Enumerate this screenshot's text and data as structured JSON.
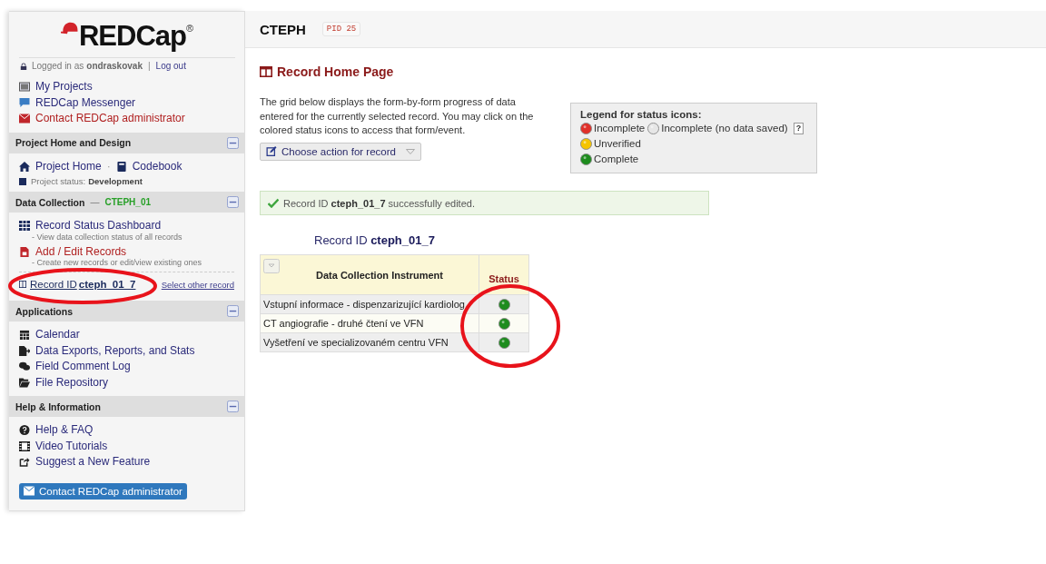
{
  "logo": {
    "text": "REDCap",
    "mark": "®"
  },
  "login": {
    "prefix": "Logged in as",
    "user": "ondraskovak",
    "divider": "|",
    "logout": "Log out"
  },
  "top_links": [
    {
      "label": "My Projects",
      "kind": "normal"
    },
    {
      "label": "REDCap Messenger",
      "kind": "normal"
    },
    {
      "label": "Contact REDCap administrator",
      "kind": "alert"
    }
  ],
  "project_home": {
    "title": "Project Home and Design",
    "links": [
      "Project Home",
      "Codebook"
    ],
    "separator": "·",
    "status_label": "Project status:",
    "status": "Development"
  },
  "data_collection": {
    "title": "Data Collection",
    "separator": "—",
    "arm": "CTEPH_01",
    "items": [
      {
        "label": "Record Status Dashboard",
        "note": "- View data collection status of all records",
        "kind": "normal"
      },
      {
        "label": "Add / Edit Records",
        "note": "- Create new records or edit/view existing ones",
        "kind": "alert"
      }
    ],
    "record": {
      "prefix": "Record ID",
      "id": "cteph_01_7",
      "circled": true
    },
    "select_other": "Select other record"
  },
  "applications": {
    "title": "Applications",
    "items": [
      "Calendar",
      "Data Exports, Reports, and Stats",
      "Field Comment Log",
      "File Repository"
    ]
  },
  "help": {
    "title": "Help & Information",
    "items": [
      "Help & FAQ",
      "Video Tutorials",
      "Suggest a New Feature"
    ]
  },
  "contact_button": "Contact REDCap administrator",
  "header": {
    "title": "CTEPH",
    "pid": "PID 25"
  },
  "page_title": "Record Home Page",
  "description": "The grid below displays the form-by-form progress of data entered for the currently selected record. You may click on the colored status icons to access that form/event.",
  "action_button": "Choose action for record",
  "message": {
    "prefix": "Record ID",
    "id": "cteph_01_7",
    "suffix": "successfully edited."
  },
  "legend": {
    "title": "Legend for status icons:",
    "help": "?",
    "items": [
      {
        "label": "Incomplete",
        "color": "#e0302a"
      },
      {
        "label": "Incomplete (no data saved)",
        "color": "#e6e6e6"
      },
      {
        "label": "Unverified",
        "color": "#f5c400"
      },
      {
        "label": "Complete",
        "color": "#1e8c1e"
      }
    ]
  },
  "grid": {
    "title_prefix": "Record ID",
    "record_id": "cteph_01_7",
    "columns": [
      "Data Collection Instrument",
      "Status"
    ],
    "status_circled": true,
    "rows": [
      {
        "instrument": "Vstupní informace - dispenzarizující kardiolog",
        "color": "#1e8c1e"
      },
      {
        "instrument": "CT angiografie - druhé čtení ve VFN",
        "color": "#1e8c1e"
      },
      {
        "instrument": "Vyšetření ve specializovaném centru VFN",
        "color": "#1e8c1e"
      }
    ]
  }
}
